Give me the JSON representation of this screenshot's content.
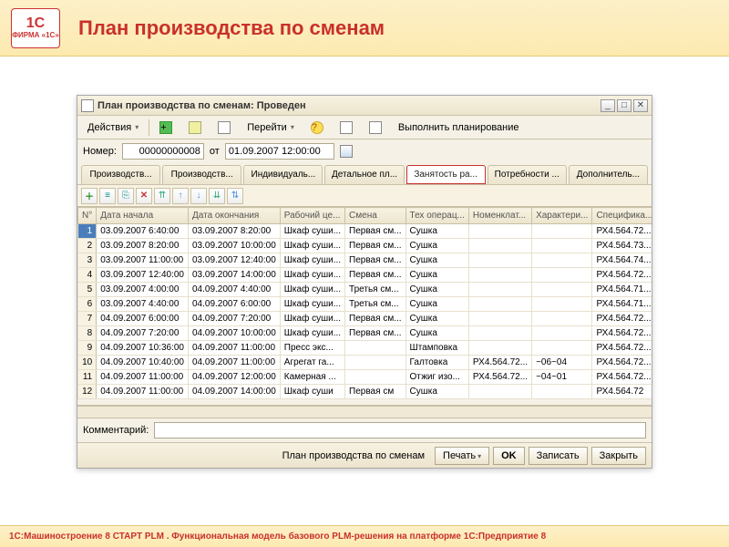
{
  "page": {
    "logo_top": "1С",
    "logo_bottom": "ФИРМА «1С»",
    "title": "План производства по сменам",
    "footer": "1С:Машиностроение 8 СТАРТ PLM . Функциональная модель базового PLM-решения на платформе 1С:Предприятие 8"
  },
  "window": {
    "title": "План производства по сменам: Проведен",
    "toolbar": {
      "actions": "Действия",
      "goto": "Перейти",
      "plan": "Выполнить планирование"
    },
    "form": {
      "number_label": "Номер:",
      "number_value": "00000000008",
      "from_label": "от",
      "date_value": "01.09.2007 12:00:00"
    },
    "tabs": [
      "Производств...",
      "Производств...",
      "Индивидуаль...",
      "Детальное пл...",
      "Занятость ра...",
      "Потребности ...",
      "Дополнитель..."
    ],
    "active_tab": 4,
    "columns": [
      "N°",
      "Дата начала",
      "Дата окончания",
      "Рабочий це...",
      "Смена",
      "Тех операц...",
      "Номенклат...",
      "Характери...",
      "Специфика..."
    ],
    "rows": [
      {
        "n": "1",
        "start": "03.09.2007 6:40:00",
        "end": "03.09.2007 8:20:00",
        "wc": "Шкаф суши...",
        "shift": "Первая см...",
        "op": "Сушка",
        "nom": "",
        "char": "",
        "spec": "РХ4.564.72..."
      },
      {
        "n": "2",
        "start": "03.09.2007 8:20:00",
        "end": "03.09.2007 10:00:00",
        "wc": "Шкаф суши...",
        "shift": "Первая см...",
        "op": "Сушка",
        "nom": "",
        "char": "",
        "spec": "РХ4.564.73..."
      },
      {
        "n": "3",
        "start": "03.09.2007 11:00:00",
        "end": "03.09.2007 12:40:00",
        "wc": "Шкаф суши...",
        "shift": "Первая см...",
        "op": "Сушка",
        "nom": "",
        "char": "",
        "spec": "РХ4.564.74..."
      },
      {
        "n": "4",
        "start": "03.09.2007 12:40:00",
        "end": "03.09.2007 14:00:00",
        "wc": "Шкаф суши...",
        "shift": "Первая см...",
        "op": "Сушка",
        "nom": "",
        "char": "",
        "spec": "РХ4.564.72..."
      },
      {
        "n": "5",
        "start": "03.09.2007 4:00:00",
        "end": "04.09.2007 4:40:00",
        "wc": "Шкаф суши...",
        "shift": "Третья см...",
        "op": "Сушка",
        "nom": "",
        "char": "",
        "spec": "РХ4.564.71..."
      },
      {
        "n": "6",
        "start": "03.09.2007 4:40:00",
        "end": "04.09.2007 6:00:00",
        "wc": "Шкаф суши...",
        "shift": "Третья см...",
        "op": "Сушка",
        "nom": "",
        "char": "",
        "spec": "РХ4.564.71..."
      },
      {
        "n": "7",
        "start": "04.09.2007 6:00:00",
        "end": "04.09.2007 7:20:00",
        "wc": "Шкаф суши...",
        "shift": "Первая см...",
        "op": "Сушка",
        "nom": "",
        "char": "",
        "spec": "РХ4.564.72..."
      },
      {
        "n": "8",
        "start": "04.09.2007 7:20:00",
        "end": "04.09.2007 10:00:00",
        "wc": "Шкаф суши...",
        "shift": "Первая см...",
        "op": "Сушка",
        "nom": "",
        "char": "",
        "spec": "РХ4.564.72..."
      },
      {
        "n": "9",
        "start": "04.09.2007 10:36:00",
        "end": "04.09.2007 11:00:00",
        "wc": "Пресс экс...",
        "shift": "",
        "op": "Штамповка",
        "nom": "",
        "char": "",
        "spec": "РХ4.564.72..."
      },
      {
        "n": "10",
        "start": "04.09.2007 10:40:00",
        "end": "04.09.2007 11:00:00",
        "wc": "Агрегат га...",
        "shift": "",
        "op": "Галтовка",
        "nom": "РХ4.564.72...",
        "char": "~06~04",
        "spec": "РХ4.564.72..."
      },
      {
        "n": "11",
        "start": "04.09.2007 11:00:00",
        "end": "04.09.2007 12:00:00",
        "wc": "Камерная ...",
        "shift": "",
        "op": "Отжиг изо...",
        "nom": "РХ4.564.72...",
        "char": "~04~01",
        "spec": "РХ4.564.72..."
      },
      {
        "n": "12",
        "start": "04.09.2007 11:00:00",
        "end": "04.09.2007 14:00:00",
        "wc": "Шкаф суши",
        "shift": "Первая см",
        "op": "Сушка",
        "nom": "",
        "char": "",
        "spec": "РХ4.564.72"
      }
    ],
    "comment_label": "Комментарий:",
    "footer_buttons": {
      "link": "План производства по сменам",
      "print": "Печать",
      "ok": "OK",
      "save": "Записать",
      "close": "Закрыть"
    }
  }
}
